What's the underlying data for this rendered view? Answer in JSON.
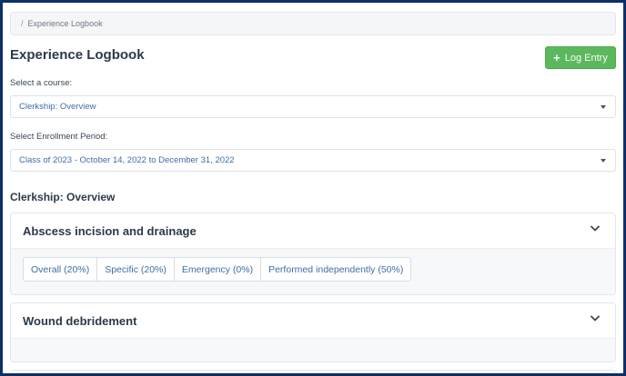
{
  "breadcrumb": {
    "separator": "/",
    "current": "Experience Logbook"
  },
  "page": {
    "title": "Experience Logbook",
    "log_button": {
      "icon": "plus-icon",
      "label": "Log Entry",
      "color": "#5cb85c"
    }
  },
  "course_select": {
    "label": "Select a course:",
    "value": "Clerkship: Overview"
  },
  "period_select": {
    "label": "Select Enrollment Period:",
    "value": "Class of 2023 - October 14, 2022 to December 31, 2022"
  },
  "section": {
    "title": "Clerkship: Overview"
  },
  "panels": [
    {
      "title": "Abscess incision and drainage",
      "expanded": true,
      "tags": [
        "Overall (20%)",
        "Specific (20%)",
        "Emergency (0%)",
        "Performed independently (50%)"
      ]
    },
    {
      "title": "Wound debridement",
      "expanded": true,
      "tags": []
    }
  ],
  "colors": {
    "frame": "#0e2d6b",
    "link": "#3d6ea5",
    "success": "#5cb85c"
  }
}
